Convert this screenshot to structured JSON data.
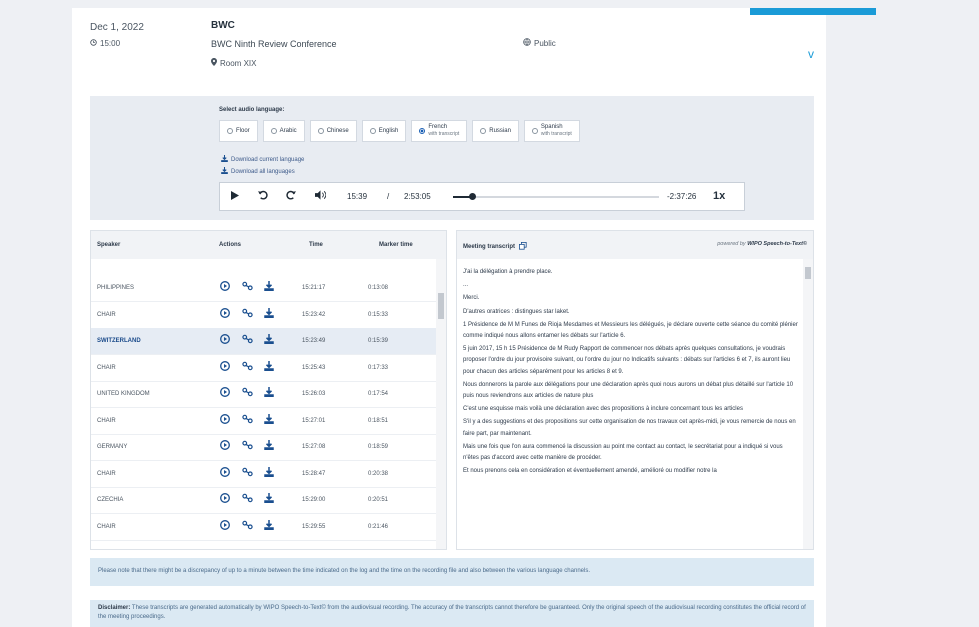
{
  "meeting": {
    "date": "Dec 1, 2022",
    "time": "15:00",
    "org": "BWC",
    "name": "BWC Ninth Review Conference",
    "room": "Room XIX",
    "visibility": "Public"
  },
  "audio": {
    "select_label": "Select audio language:",
    "languages": [
      {
        "name": "Floor",
        "sub": "",
        "selected": false
      },
      {
        "name": "Arabic",
        "sub": "",
        "selected": false
      },
      {
        "name": "Chinese",
        "sub": "",
        "selected": false
      },
      {
        "name": "English",
        "sub": "",
        "selected": false
      },
      {
        "name": "French",
        "sub": "with transcript",
        "selected": true
      },
      {
        "name": "Russian",
        "sub": "",
        "selected": false
      },
      {
        "name": "Spanish",
        "sub": "with transcript",
        "selected": false
      }
    ],
    "download_current": "Download current language",
    "download_all": "Download all languages",
    "player": {
      "current": "15:39",
      "separator": "/",
      "duration": "2:53:05",
      "remaining": "-2:37:26",
      "speed": "1x",
      "progress": 0.09
    }
  },
  "table": {
    "headers": {
      "speaker": "Speaker",
      "actions": "Actions",
      "time": "Time",
      "marker": "Marker time"
    },
    "rows": [
      {
        "speaker": "PHILIPPINES",
        "time": "15:21:17",
        "marker": "0:13:08"
      },
      {
        "speaker": "CHAIR",
        "time": "15:23:42",
        "marker": "0:15:33"
      },
      {
        "speaker": "SWITZERLAND",
        "time": "15:23:49",
        "marker": "0:15:39"
      },
      {
        "speaker": "CHAIR",
        "time": "15:25:43",
        "marker": "0:17:33"
      },
      {
        "speaker": "UNITED KINGDOM",
        "time": "15:26:03",
        "marker": "0:17:54"
      },
      {
        "speaker": "CHAIR",
        "time": "15:27:01",
        "marker": "0:18:51"
      },
      {
        "speaker": "GERMANY",
        "time": "15:27:08",
        "marker": "0:18:59"
      },
      {
        "speaker": "CHAIR",
        "time": "15:28:47",
        "marker": "0:20:38"
      },
      {
        "speaker": "CZECHIA",
        "time": "15:29:00",
        "marker": "0:20:51"
      },
      {
        "speaker": "CHAIR",
        "time": "15:29:55",
        "marker": "0:21:46"
      }
    ],
    "selected_index": 2
  },
  "transcript": {
    "title": "Meeting transcript",
    "powered_prefix": "powered by",
    "powered_by": "WIPO Speech-to-Text©",
    "lines": [
      "J'ai la délégation à prendre place.",
      "...",
      "Merci.",
      "D'autres oratrices : distingues star laket.",
      "1 Présidence de M M Funes de Rioja Mesdames et Messieurs les délégués, je déclare ouverte cette séance du comité plénier comme indiqué nous allons entamer les débats sur l'article 6.",
      "5 juin 2017, 15 h 15 Présidence de M Rudy Rapport de commencer nos débats après quelques consultations, je voudrais proposer l'ordre du jour provisoire suivant, ou l'ordre du jour no Indicatifs suivants : débats sur l'articles 6 et 7, ils auront lieu pour chacun des articles séparément pour les articles 8 et 9.",
      "Nous donnerons la parole aux délégations pour une déclaration après quoi nous aurons un débat plus détaillé sur l'article 10 puis nous reviendrons aux articles de nature plus",
      "C'est une esquisse mais voilà une déclaration avec des propositions à inclure concernant tous les articles",
      "S'il y a des suggestions et des propositions sur cette organisation de nos travaux cet après-midi, je vous remercie de nous en faire part, par maintenant.",
      "Mais une fois que l'on aura commencé la discussion au point me contact au contact, le secrétariat pour a indiqué si vous n'êtes pas d'accord avec cette manière de procéder.",
      "Et nous prenons cela en considération et éventuellement amendé, amélioré ou modifier notre la"
    ]
  },
  "notice": "Please note that there might be a discrepancy of up to a minute between the time indicated on the log and the time on the recording file and also between the various language channels.",
  "disclaimer": {
    "label": "Disclaimer:",
    "text": "These transcripts are generated automatically by WIPO Speech-to-Text© from the audiovisual recording. The accuracy of the transcripts cannot therefore be guaranteed. Only the original speech of the audiovisual recording constitutes the official record of the meeting proceedings."
  },
  "colors": {
    "accent": "#1a9bd7",
    "link": "#1a4f8f",
    "panel": "#e8ecf2",
    "notice": "#dbe9f3"
  }
}
